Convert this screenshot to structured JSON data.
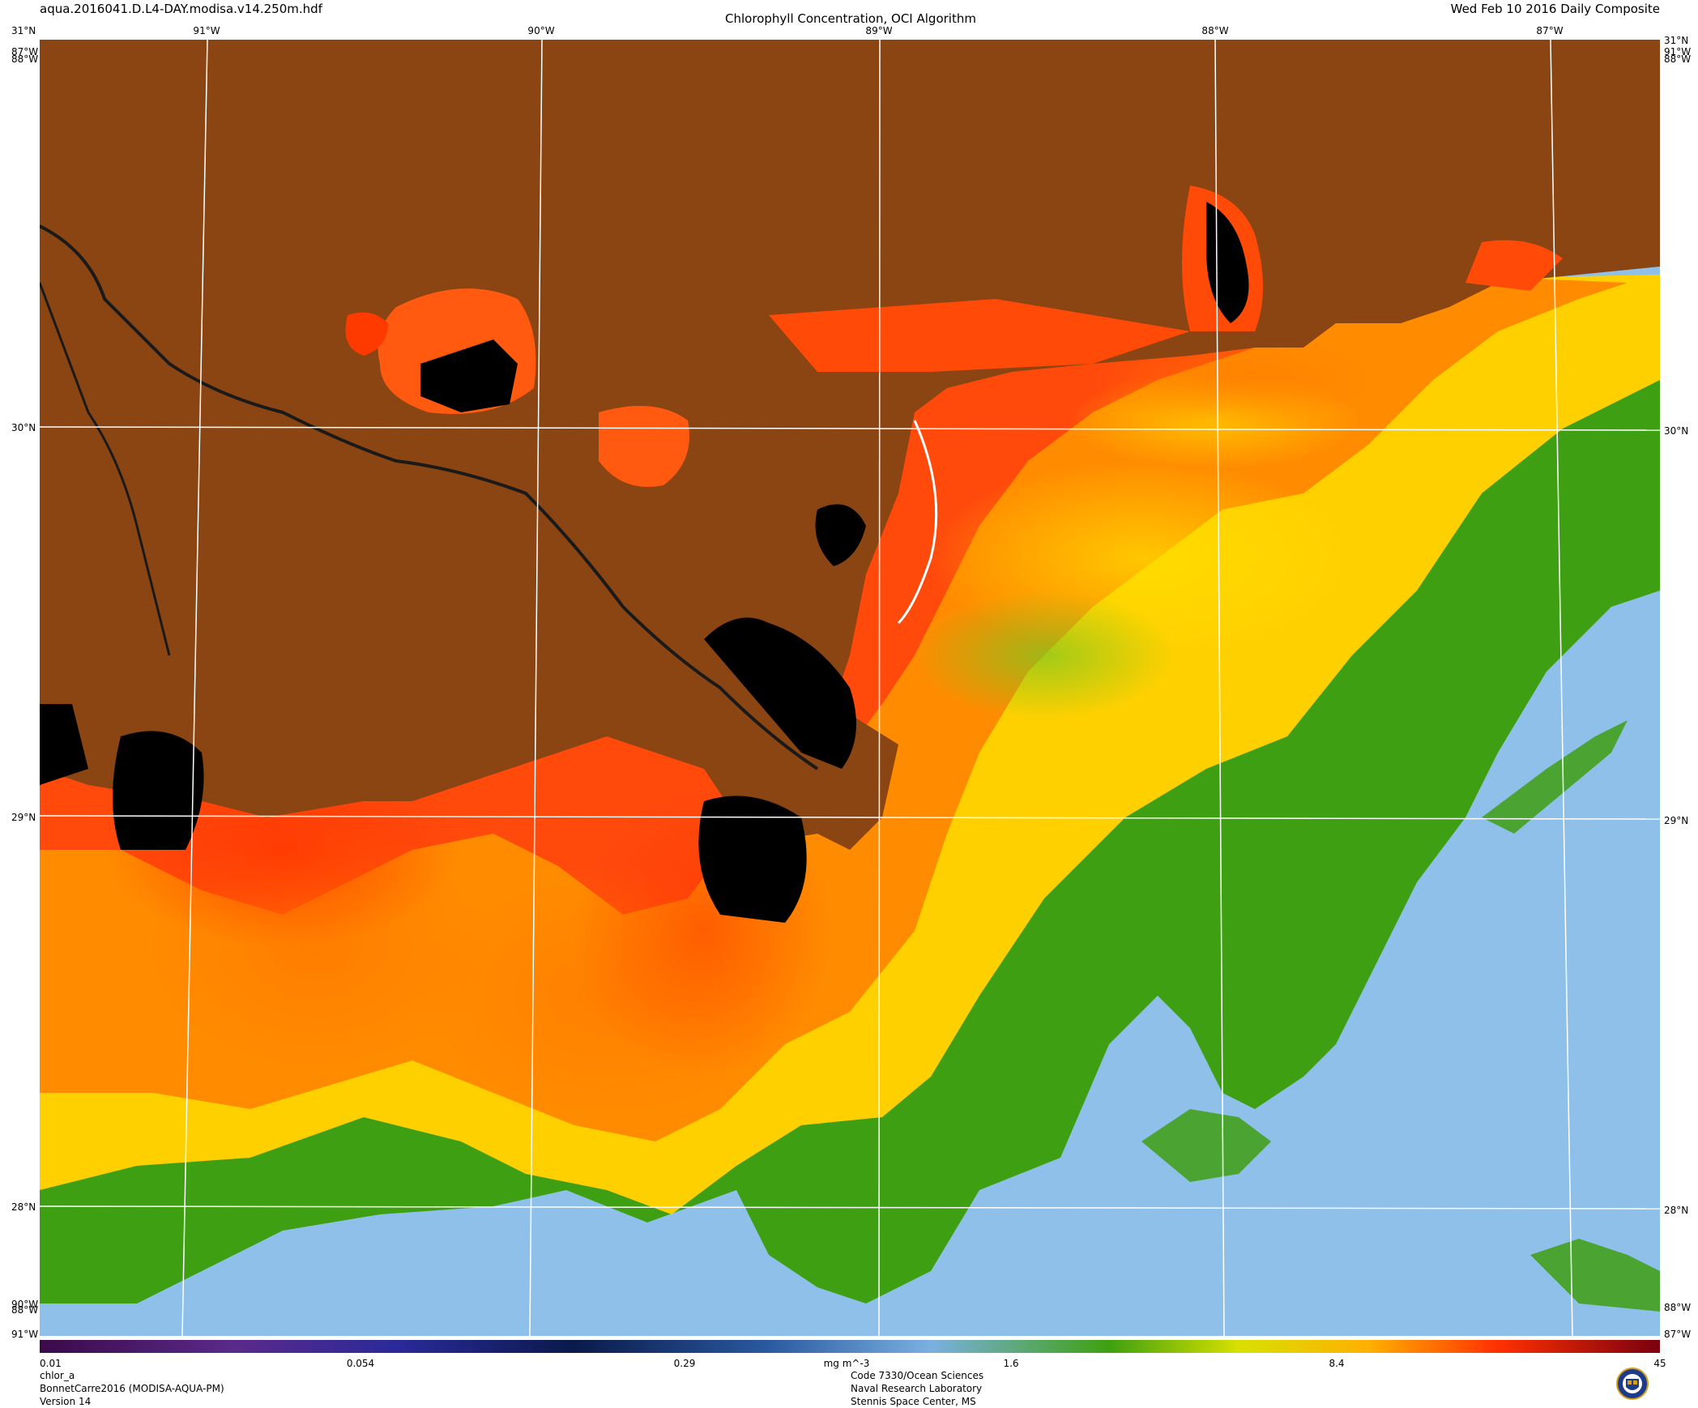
{
  "header": {
    "filename": "aqua.2016041.D.L4-DAY.modisa.v14.250m.hdf",
    "title": "Chlorophyll Concentration, OCI Algorithm",
    "date": "Wed Feb 10 2016 Daily Composite"
  },
  "grid": {
    "lon_top": [
      "91°W",
      "90°W",
      "89°W",
      "88°W",
      "87°W"
    ],
    "lat_left": [
      "31°N",
      "30°N",
      "29°N",
      "28°N"
    ],
    "lat_right": [
      "31°N",
      "30°N",
      "29°N",
      "28°N"
    ],
    "corner_top_left": "31°N",
    "corner_top_left_lon": "87°W",
    "corner_top_left_lon2": "88°W",
    "corner_top_right": "31°N",
    "corner_top_right_lon": "91°W",
    "corner_top_right_lon2": "88°W",
    "corner_bottom_left_lon": "90°W",
    "corner_bottom_left_lon2": "88°W",
    "corner_bottom_left_lon3": "91°W",
    "corner_bottom_right_lon": "88°W",
    "corner_bottom_right_lon2": "87°W"
  },
  "colorbar": {
    "ticks": [
      "0.01",
      "0.054",
      "0.29",
      "mg m^-3",
      "1.6",
      "8.4",
      "45"
    ],
    "scale": "log",
    "range": [
      0.01,
      45
    ]
  },
  "footer_left": {
    "variable": "chlor_a",
    "region": "BonnetCarre2016 (MODISA-AQUA-PM)",
    "version": "Version 14"
  },
  "footer_center": {
    "line1": "Code 7330/Ocean Sciences",
    "line2": "Naval Research Laboratory",
    "line3": "Stennis Space Center, MS"
  },
  "colors": {
    "land": "#8b4513",
    "ocean_clear": "#8ec0ea",
    "high_chl": "#ff2a00",
    "mid_chl": "#ffd400",
    "low_chl": "#3fa510",
    "no_data": "#000000"
  }
}
